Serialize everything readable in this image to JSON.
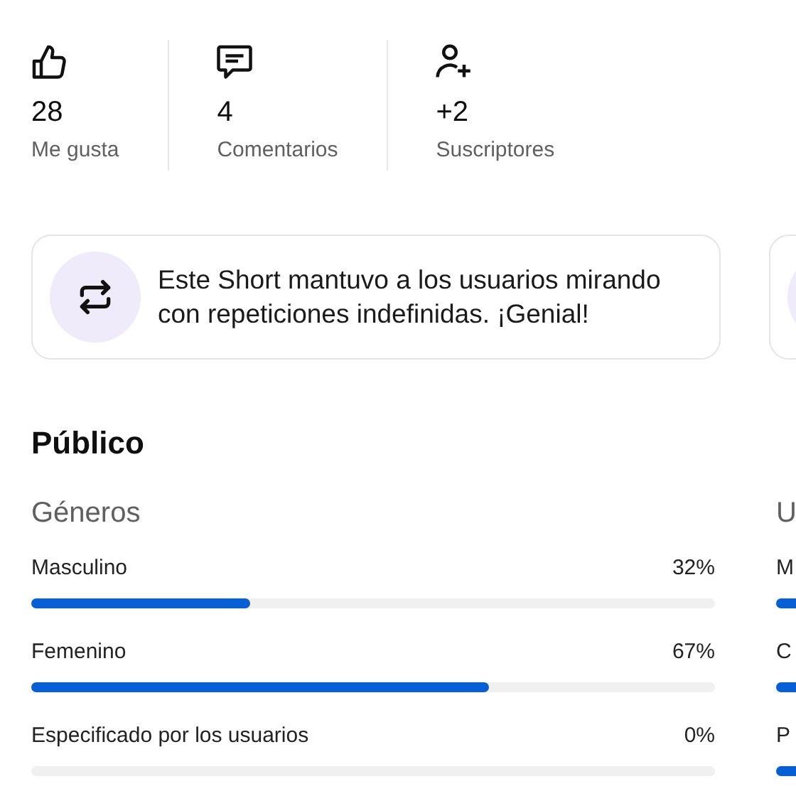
{
  "stats": [
    {
      "kind": "likes",
      "value": "28",
      "label": "Me gusta"
    },
    {
      "kind": "comments",
      "value": "4",
      "label": "Comentarios"
    },
    {
      "kind": "subscribers",
      "value": "+2",
      "label": "Suscriptores"
    }
  ],
  "highlights": [
    {
      "kind": "repeat",
      "text": "Este Short mantuvo a los usuarios mirando con repeticiones indefinidas. ¡Genial!"
    }
  ],
  "audience": {
    "title": "Público",
    "sections": [
      {
        "title": "Géneros",
        "rows": [
          {
            "label": "Masculino",
            "value": "32%",
            "level": 0.32
          },
          {
            "label": "Femenino",
            "value": "67%",
            "level": 0.67
          },
          {
            "label": "Especificado por los usuarios",
            "value": "0%"
          }
        ]
      },
      {
        "title": "U",
        "rows": [
          {
            "label": "M"
          },
          {
            "label": "C"
          },
          {
            "label": "P"
          }
        ]
      }
    ]
  }
}
